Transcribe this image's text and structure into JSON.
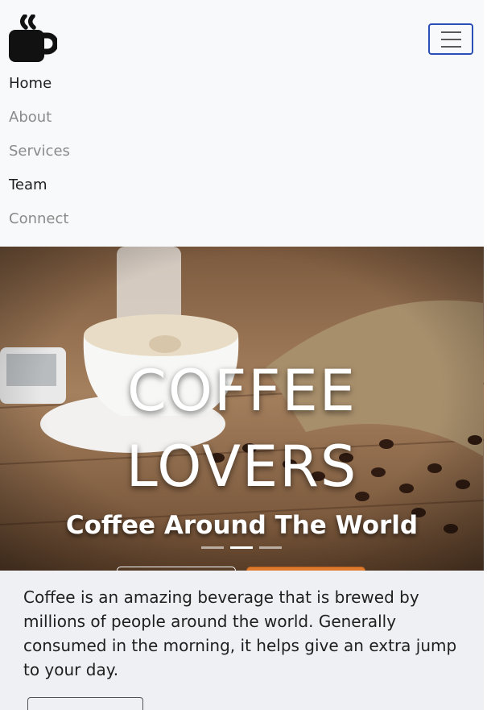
{
  "nav": {
    "items": [
      {
        "label": "Home"
      },
      {
        "label": "About"
      },
      {
        "label": "Services"
      },
      {
        "label": "Team"
      },
      {
        "label": "Connect"
      }
    ]
  },
  "hero": {
    "title_line1": "COFFEE",
    "title_line2": "LOVERS",
    "subtitle": "Coffee Around The World",
    "active_slide": 2,
    "slide_count": 3
  },
  "info": {
    "text": "Coffee is an amazing beverage that is brewed by millions of people around the world. Generally consumed in the morning, it helps give an extra jump to your day."
  },
  "colors": {
    "accent": "#e07a2d",
    "navbar_bg": "#f8f9fa",
    "toggler_border": "#2c4fb5"
  },
  "icons": {
    "logo": "coffee-mug-icon",
    "menu": "hamburger-menu-icon"
  }
}
